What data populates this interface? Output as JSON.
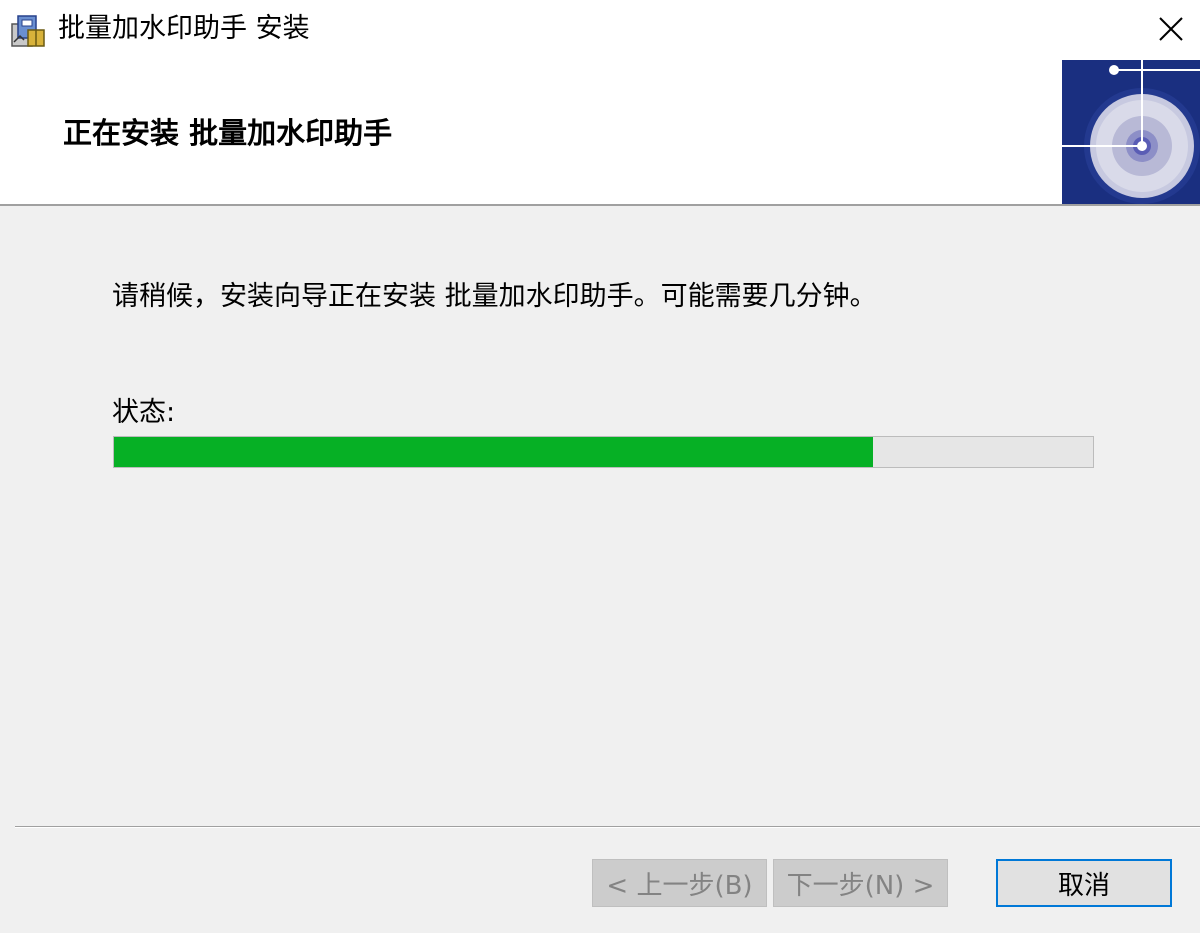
{
  "window": {
    "title": "批量加水印助手 安装",
    "close_glyph": "✕"
  },
  "banner": {
    "title": "正在安装 批量加水印助手"
  },
  "content": {
    "message": "请稍候，安装向导正在安装 批量加水印助手。可能需要几分钟。",
    "status_label": "状态:",
    "progress_percent": 77.5
  },
  "buttons": {
    "back_label": "< 上一步(B)",
    "next_label": "下一步(N) >",
    "cancel_label": "取消"
  },
  "colors": {
    "progress_fill": "#06b025",
    "banner_image_bg": "#1a2f80",
    "cancel_focus_border": "#0078d7"
  },
  "icons": {
    "title_icon": "installer-package-icon",
    "banner_icon": "cd-disc-icon",
    "close_icon": "close-icon"
  }
}
